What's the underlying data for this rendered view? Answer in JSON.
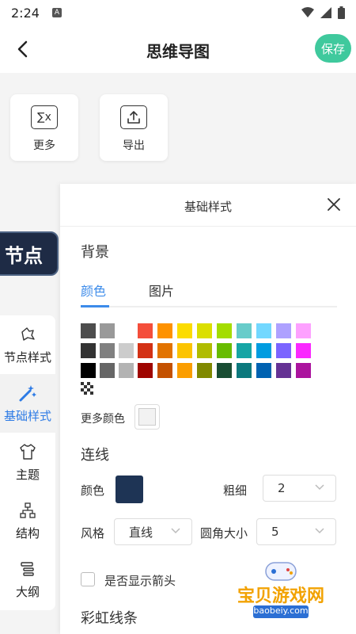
{
  "status": {
    "time": "2:24",
    "a_label": "A"
  },
  "header": {
    "title": "思维导图",
    "save_label": "保存"
  },
  "tools": [
    {
      "icon": "sigma-icon",
      "label": "更多",
      "symbol": "∑x"
    },
    {
      "icon": "export-icon",
      "label": "导出"
    }
  ],
  "node": {
    "label": "节点"
  },
  "side_tabs": [
    {
      "label": "节点样式",
      "icon": "node-style-icon"
    },
    {
      "label": "基础样式",
      "icon": "magic-wand-icon",
      "active": true
    },
    {
      "label": "主题",
      "icon": "shirt-icon"
    },
    {
      "label": "结构",
      "icon": "structure-icon"
    },
    {
      "label": "大纲",
      "icon": "outline-icon"
    }
  ],
  "panel": {
    "title": "基础样式",
    "background": {
      "title": "背景",
      "tabs": [
        "颜色",
        "图片"
      ],
      "more_color_label": "更多颜色"
    },
    "line": {
      "title": "连线",
      "color_label": "颜色",
      "color": "#1e3455",
      "thickness_label": "粗细",
      "thickness_value": "2",
      "style_label": "风格",
      "style_value": "直线",
      "radius_label": "圆角大小",
      "radius_value": "5",
      "arrow_label": "是否显示箭头"
    },
    "rainbow_title": "彩虹线条"
  },
  "swatch_rows": [
    [
      "#4d4d4d",
      "#999999",
      "#ffffff",
      "#f44e3b",
      "#fe9200",
      "#fcdc00",
      "#dbdf00",
      "#a4dd00",
      "#68ccca",
      "#73d8ff",
      "#aea1ff",
      "#fda1ff"
    ],
    [
      "#333333",
      "#808080",
      "#cccccc",
      "#d33115",
      "#e27300",
      "#fcc400",
      "#b0bc00",
      "#68bc00",
      "#16a5a5",
      "#009ce0",
      "#7b64ff",
      "#fa28ff"
    ],
    [
      "#000000",
      "#666666",
      "#b3b3b3",
      "#9f0500",
      "#c45100",
      "#fb9e00",
      "#808900",
      "#194d33",
      "#0c797d",
      "#0062b1",
      "#653294",
      "#ab149e"
    ]
  ],
  "watermark": {
    "text": "宝贝游戏网",
    "url": "baobeiy.com"
  }
}
